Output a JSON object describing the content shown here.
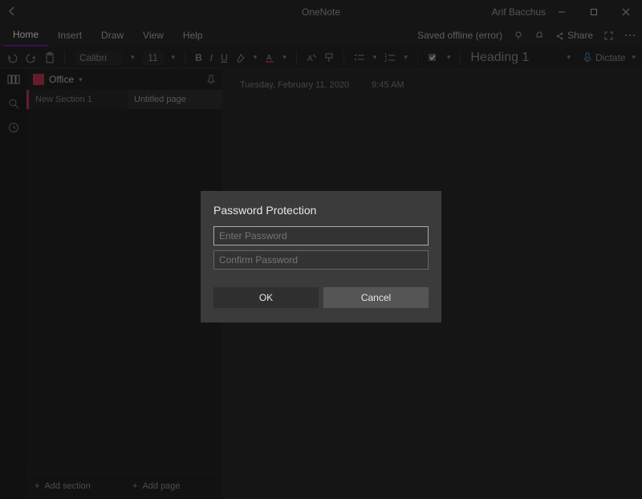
{
  "titlebar": {
    "app": "OneNote",
    "user": "Arif Bacchus"
  },
  "menu": {
    "tabs": [
      "Home",
      "Insert",
      "Draw",
      "View",
      "Help"
    ],
    "status": "Saved offline (error)",
    "share": "Share"
  },
  "ribbon": {
    "font": "Calibri",
    "size": "11",
    "style": "Heading 1",
    "dictate": "Dictate"
  },
  "leftrail": {
    "icons": [
      "notebook",
      "search",
      "recent"
    ]
  },
  "panel": {
    "notebook": "Office",
    "section": "New Section 1",
    "page": "Untitled page",
    "add_section": "Add section",
    "add_page": "Add page"
  },
  "content": {
    "date": "Tuesday, February 11, 2020",
    "time": "9:45 AM"
  },
  "dialog": {
    "title": "Password Protection",
    "enter_ph": "Enter Password",
    "confirm_ph": "Confirm Password",
    "ok": "OK",
    "cancel": "Cancel"
  }
}
